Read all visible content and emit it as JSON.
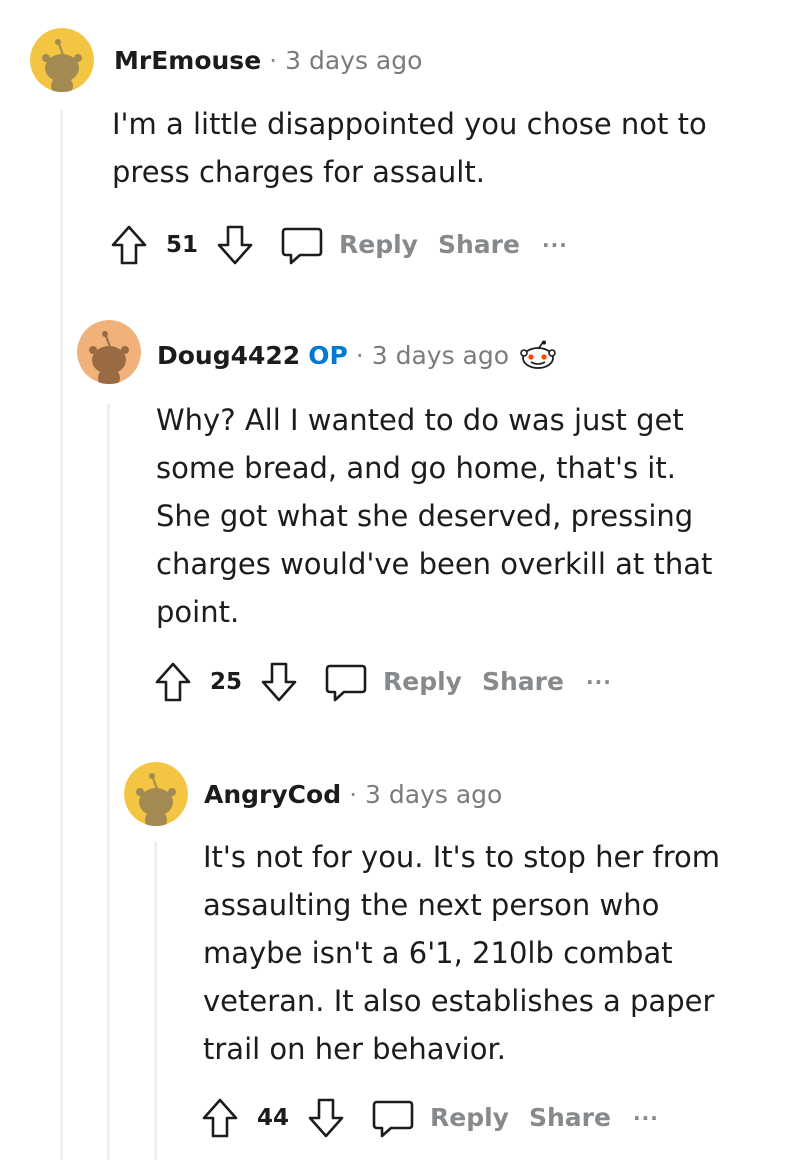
{
  "comments": [
    {
      "author": "MrEmouse",
      "op_badge": "",
      "separator": "·",
      "time": "3 days ago",
      "body": "I'm a little disappointed you chose not to press charges for assault.",
      "score": "51",
      "reply_label": "Reply",
      "share_label": "Share",
      "more_label": "···",
      "avatar_color": "#f4c542"
    },
    {
      "author": "Doug4422",
      "op_badge": "OP",
      "separator": "·",
      "time": "3 days ago",
      "body": "Why? All I wanted to do was just get some bread, and go home, that's it. She got what she deserved, pressing charges would've been overkill at that point.",
      "score": "25",
      "reply_label": "Reply",
      "share_label": "Share",
      "more_label": "···",
      "avatar_color": "#f0b27a"
    },
    {
      "author": "AngryCod",
      "op_badge": "",
      "separator": "·",
      "time": "3 days ago",
      "body": "It's not for you. It's to stop her from assaulting the next person who maybe isn't a 6'1, 210lb combat veteran. It also establishes a paper trail on her behavior.",
      "score": "44",
      "reply_label": "Reply",
      "share_label": "Share",
      "more_label": "···",
      "avatar_color": "#f4c542"
    }
  ],
  "colors": {
    "op_blue": "#0079d3",
    "muted": "#878a8c",
    "thread_line": "#edeff1"
  },
  "icons": [
    "snoo-avatar-icon",
    "award-icon",
    "upvote-icon",
    "downvote-icon",
    "comment-bubble-icon"
  ]
}
